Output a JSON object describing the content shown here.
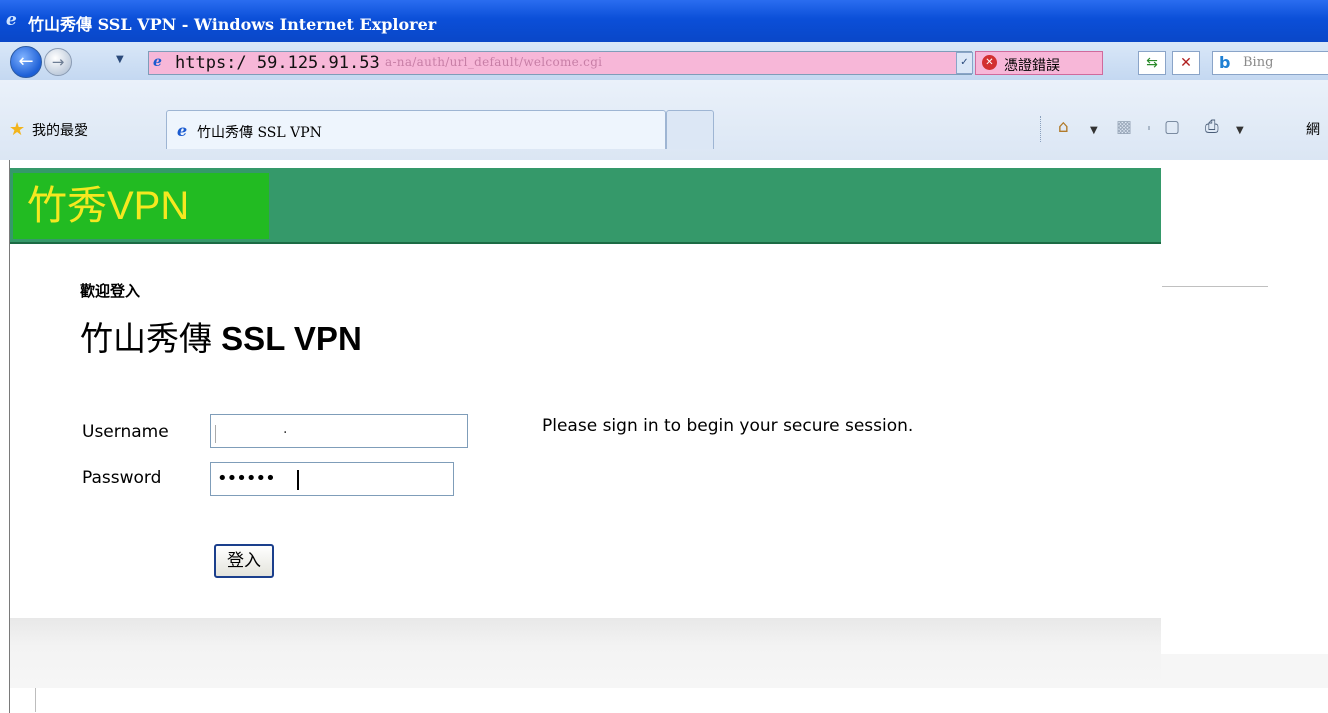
{
  "window": {
    "title": "竹山秀傳 SSL VPN - Windows Internet Explorer"
  },
  "address_bar": {
    "url_visible": "https:/ 59.125.91.53",
    "url_rest": "a-na/auth/url_default/welcome.cgi",
    "cert_error_label": "憑證錯誤",
    "search_placeholder": "Bing"
  },
  "favorites_bar": {
    "favorites_label": "我的最愛",
    "tab_label": "竹山秀傳 SSL VPN",
    "page_menu_label": "網"
  },
  "page": {
    "logo_text": "竹秀VPN",
    "welcome": "歡迎登入",
    "title_prefix": "竹山秀傳 ",
    "title_bold": "SSL VPN",
    "username_label": "Username",
    "username_value": ".",
    "password_label": "Password",
    "password_value": "••••••",
    "hint": "Please sign in to begin your secure session.",
    "signin_button": "登入"
  },
  "colors": {
    "header_green": "#35996a",
    "logo_green": "#22bb22",
    "logo_text_yellow": "#f5e820",
    "url_error_pink": "#f7b7d8",
    "titlebar_blue": "#0b4fd8"
  },
  "icons": {
    "title": "ie-icon",
    "back": "back-arrow-icon",
    "forward": "forward-arrow-icon",
    "cert": "shield-error-icon",
    "refresh": "refresh-icon",
    "stop": "stop-icon",
    "search": "bing-icon",
    "favorites": "star-icon",
    "home": "home-icon",
    "feeds": "rss-icon",
    "mail": "mail-icon",
    "print": "printer-icon"
  }
}
